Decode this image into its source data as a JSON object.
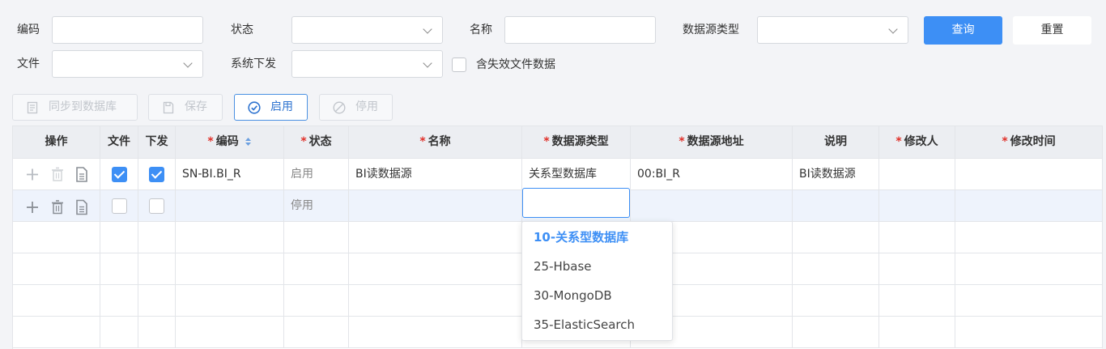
{
  "filter": {
    "code_label": "编码",
    "status_label": "状态",
    "name_label": "名称",
    "datasource_type_label": "数据源类型",
    "file_label": "文件",
    "system_dispatch_label": "系统下发",
    "include_invalid_label": "含失效文件数据",
    "query_button": "查询",
    "reset_button": "重置"
  },
  "toolbar": {
    "sync_label": "同步到数据库",
    "save_label": "保存",
    "enable_label": "启用",
    "disable_label": "停用"
  },
  "table": {
    "headers": {
      "ops": "操作",
      "file": "文件",
      "dispatch": "下发",
      "code": "编码",
      "status": "状态",
      "name": "名称",
      "ds_type": "数据源类型",
      "ds_address": "数据源地址",
      "desc": "说明",
      "modifier": "修改人",
      "modified_time": "修改时间"
    },
    "rows": [
      {
        "file_checked": true,
        "dispatch_checked": true,
        "code": "SN-BI.BI_R",
        "status": "启用",
        "name": "BI读数据源",
        "ds_type": "关系型数据库",
        "ds_address": "00:BI_R",
        "desc": "BI读数据源",
        "modifier": "",
        "modified_time": ""
      },
      {
        "file_checked": false,
        "dispatch_checked": false,
        "code": "",
        "status": "停用",
        "name": "",
        "ds_type": "",
        "ds_address": "",
        "desc": "",
        "modifier": "",
        "modified_time": ""
      }
    ]
  },
  "dropdown": {
    "options": [
      "10-关系型数据库",
      "25-Hbase",
      "30-MongoDB",
      "35-ElasticSearch"
    ],
    "selected": "10-关系型数据库"
  },
  "colors": {
    "primary": "#3d8ff5",
    "required": "#e0312a",
    "selected_row": "#eef3fc"
  }
}
